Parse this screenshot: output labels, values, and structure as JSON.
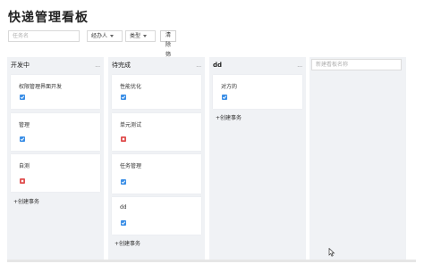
{
  "header": {
    "title": "快递管理看板"
  },
  "filters": {
    "search_placeholder": "任务名",
    "assignee_label": "经办人",
    "type_label": "类型",
    "clear_label": "清除筛选器"
  },
  "columns": [
    {
      "title": "开发中",
      "more": "...",
      "cards": [
        {
          "title": "权限管理界面开发",
          "status": "blue"
        },
        {
          "title": "管理",
          "status": "blue"
        },
        {
          "title": "自测",
          "status": "red"
        }
      ],
      "create_label": "+创建事务"
    },
    {
      "title": "待完成",
      "more": "...",
      "cards": [
        {
          "title": "性能优化",
          "status": "blue"
        },
        {
          "title": "单元测试",
          "status": "red"
        },
        {
          "title": "任务管理",
          "status": "blue"
        },
        {
          "title": "dd",
          "status": "blue"
        }
      ],
      "create_label": "+创建事务"
    },
    {
      "title": "dd",
      "more": "...",
      "cards": [
        {
          "title": "对方的",
          "status": "blue"
        }
      ],
      "create_label": "+创建事务"
    }
  ],
  "new_board": {
    "placeholder": "新建看板名称"
  },
  "colors": {
    "task_blue": "#3a8ee6",
    "bug_red": "#e05050",
    "column_bg": "#f0f2f5"
  }
}
